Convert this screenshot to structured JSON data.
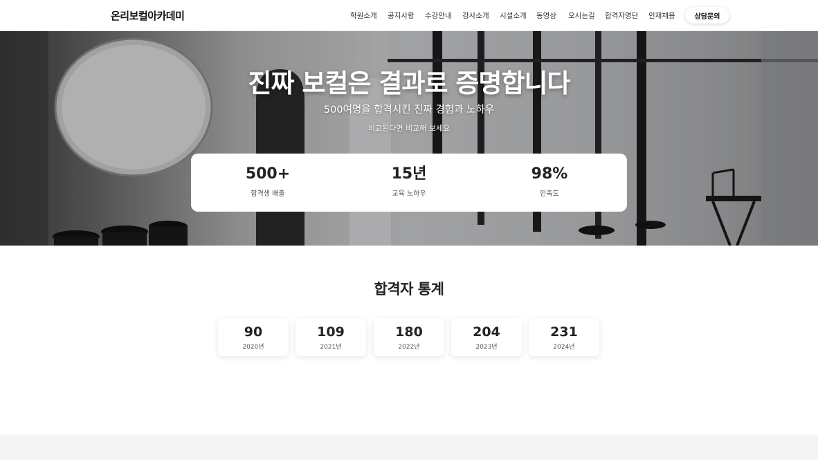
{
  "header": {
    "logo": "온리보컬아카데미",
    "nav": [
      "학원소개",
      "공지사항",
      "수강안내",
      "강사소개",
      "시설소개",
      "동영상",
      "오시는길",
      "합격자명단",
      "인재채용"
    ],
    "cta": "상담문의"
  },
  "hero": {
    "title": "진짜 보컬은 결과로 증명합니다",
    "subtitle": "500여명을 합격시킨 진짜 경험과 노하우",
    "tagline": "비교된다면 비교해 보세요",
    "stats": [
      {
        "value": "500+",
        "label": "합격생 배출"
      },
      {
        "value": "15년",
        "label": "교육 노하우"
      },
      {
        "value": "98%",
        "label": "만족도"
      }
    ]
  },
  "stats_section": {
    "title": "합격자 통계",
    "years": [
      {
        "value": "90",
        "label": "2020년"
      },
      {
        "value": "109",
        "label": "2021년"
      },
      {
        "value": "180",
        "label": "2022년"
      },
      {
        "value": "204",
        "label": "2023년"
      },
      {
        "value": "231",
        "label": "2024년"
      }
    ]
  },
  "colors": {
    "accent": "#222222",
    "card_bg": "#ffffff",
    "footer_band": "#f4f4f5"
  }
}
